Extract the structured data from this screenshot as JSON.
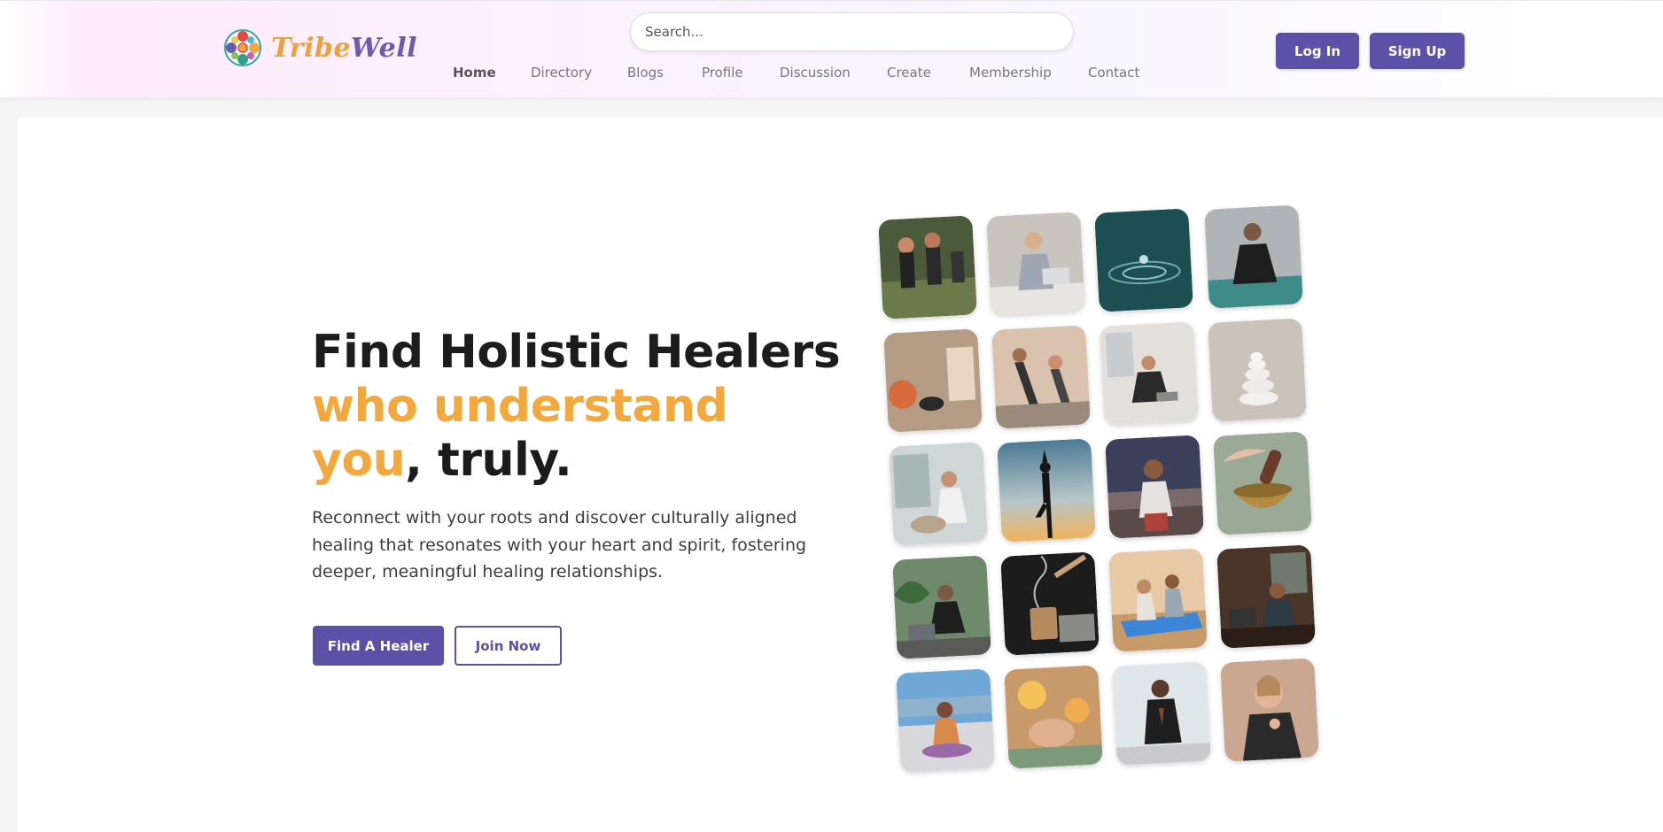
{
  "brand": {
    "name_part1": "Tribe",
    "name_part2": "Well"
  },
  "search": {
    "placeholder": "Search..."
  },
  "nav": {
    "items": [
      {
        "label": "Home",
        "active": true
      },
      {
        "label": "Directory"
      },
      {
        "label": "Blogs"
      },
      {
        "label": "Profile"
      },
      {
        "label": "Discussion"
      },
      {
        "label": "Create"
      },
      {
        "label": "Membership"
      },
      {
        "label": "Contact"
      }
    ]
  },
  "auth": {
    "login_label": "Log In",
    "signup_label": "Sign Up"
  },
  "hero": {
    "title_line1": "Find Holistic Healers",
    "title_accent1": "who understand",
    "title_accent2": "you",
    "title_end": ", truly.",
    "subtitle": "Reconnect with your roots and discover culturally aligned healing that resonates with your heart and spirit, fostering deeper, meaningful healing relationships.",
    "primary_cta": "Find A Healer",
    "secondary_cta": "Join Now"
  },
  "gallery": {
    "images": [
      "group-yoga-outdoors",
      "woman-meditating-laptop",
      "water-droplet-ripple",
      "woman-meditating-studio",
      "candle-incense-meditation",
      "couple-yoga-stretch",
      "woman-meditating-apartment",
      "zen-stacked-stones",
      "woman-yoga-stretch-window",
      "tree-pose-silhouette-sunset",
      "woman-praying-city-night",
      "singing-bowl",
      "woman-yoga-laptop-plants",
      "incense-candle-smoke",
      "couple-yoga-mat",
      "woman-meditating-dark-room",
      "woman-meditating-beach",
      "reiki-healing-session",
      "woman-namaste-pose",
      "woman-breathing-calm"
    ]
  },
  "colors": {
    "brand_purple": "#5c50a8",
    "accent_orange": "#f3a83d"
  }
}
